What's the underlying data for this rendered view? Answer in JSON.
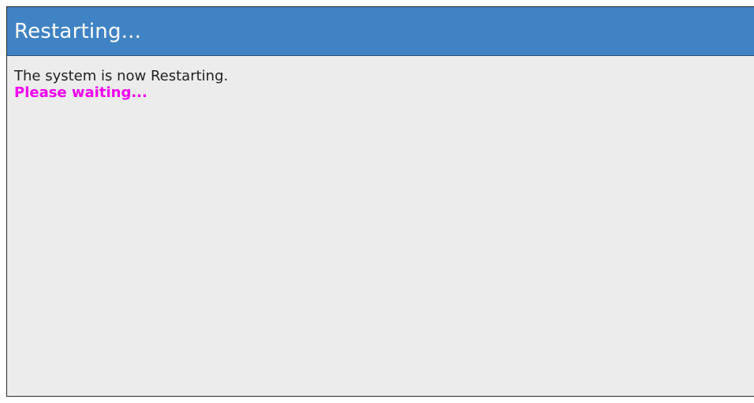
{
  "dialog": {
    "title": "Restarting...",
    "message": "The system is now Restarting.",
    "waiting_text": "Please waiting...",
    "colors": {
      "header_background": "#4083c4",
      "body_background": "#ececec",
      "waiting_text": "#f000f0"
    }
  }
}
